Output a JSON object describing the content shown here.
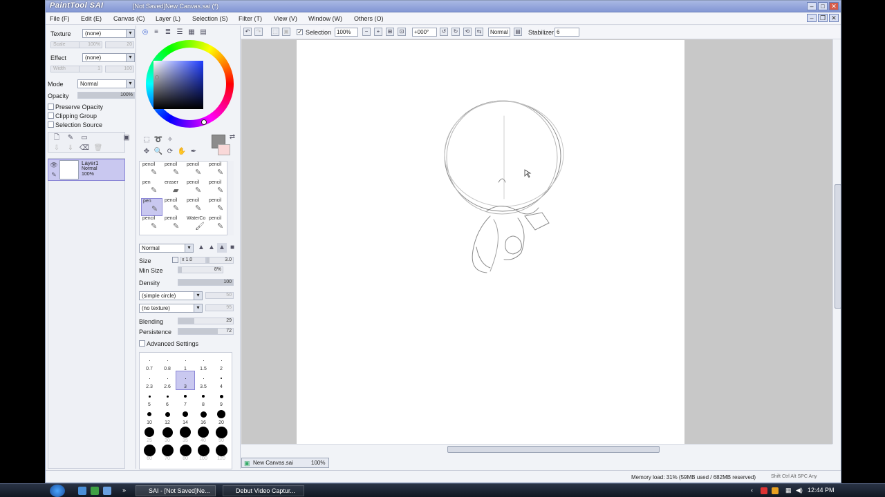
{
  "window": {
    "logo": "PaintTool SAI",
    "title": "[Not Saved]New Canvas.sai (*)"
  },
  "menu": [
    "File (F)",
    "Edit (E)",
    "Canvas (C)",
    "Layer (L)",
    "Selection (S)",
    "Filter (T)",
    "View (V)",
    "Window (W)",
    "Others (O)"
  ],
  "left": {
    "texture_label": "Texture",
    "texture_value": "(none)",
    "scale_label": "Scale",
    "scale_value": "100%",
    "scale_num": "20",
    "effect_label": "Effect",
    "effect_value": "(none)",
    "width_label": "Width",
    "width_value": "1",
    "width_num": "100",
    "mode_label": "Mode",
    "mode_value": "Normal",
    "opacity_label": "Opacity",
    "opacity_value": "100%",
    "preserve_opacity": "Preserve Opacity",
    "clipping_group": "Clipping Group",
    "selection_source": "Selection Source",
    "layer": {
      "name": "Layer1",
      "mode": "Normal",
      "opacity": "100%"
    }
  },
  "brushes": [
    {
      "name": "pencil",
      "icon": "pencil-icon"
    },
    {
      "name": "pencil",
      "icon": "pencil-icon"
    },
    {
      "name": "pencil",
      "icon": "pencil-icon"
    },
    {
      "name": "pencil",
      "icon": "pencil-icon"
    },
    {
      "name": "pen",
      "icon": "pen-icon"
    },
    {
      "name": "eraser",
      "icon": "eraser-icon"
    },
    {
      "name": "pencil",
      "icon": "pencil-icon"
    },
    {
      "name": "pencil",
      "icon": "pencil-icon"
    },
    {
      "name": "pen",
      "icon": "pen-icon",
      "selected": true
    },
    {
      "name": "pencil",
      "icon": "pencil-icon"
    },
    {
      "name": "pencil",
      "icon": "pencil-icon"
    },
    {
      "name": "pencil",
      "icon": "pencil-icon"
    },
    {
      "name": "pencil",
      "icon": "pencil-icon"
    },
    {
      "name": "pencil",
      "icon": "pencil-icon"
    },
    {
      "name": "WaterCo",
      "icon": "brush-icon"
    },
    {
      "name": "pencil",
      "icon": "pencil-icon"
    }
  ],
  "brush_settings": {
    "mode": "Normal",
    "size_label": "Size",
    "size_mult": "x 1.0",
    "size_value": "3.0",
    "minsize_label": "Min Size",
    "minsize_value": "8%",
    "minsize_fraction": 0.08,
    "density_label": "Density",
    "density_value": "100",
    "shape": "(simple circle)",
    "shape_num": "50",
    "texture": "(no texture)",
    "texture_num": "95",
    "blending_label": "Blending",
    "blending_value": "29",
    "blending_fraction": 0.29,
    "persistence_label": "Persistence",
    "persistence_value": "72",
    "persistence_fraction": 0.72,
    "advanced": "Advanced Settings"
  },
  "sizes": [
    {
      "v": "0.7",
      "d": 1
    },
    {
      "v": "0.8",
      "d": 1
    },
    {
      "v": "1",
      "d": 1
    },
    {
      "v": "1.5",
      "d": 1
    },
    {
      "v": "2",
      "d": 1
    },
    {
      "v": "2.3",
      "d": 1
    },
    {
      "v": "2.6",
      "d": 1
    },
    {
      "v": "3",
      "d": 1,
      "selected": true
    },
    {
      "v": "3.5",
      "d": 1
    },
    {
      "v": "4",
      "d": 2
    },
    {
      "v": "5",
      "d": 3
    },
    {
      "v": "6",
      "d": 3
    },
    {
      "v": "7",
      "d": 4
    },
    {
      "v": "8",
      "d": 4
    },
    {
      "v": "9",
      "d": 5
    },
    {
      "v": "10",
      "d": 6
    },
    {
      "v": "12",
      "d": 7
    },
    {
      "v": "14",
      "d": 8
    },
    {
      "v": "16",
      "d": 9
    },
    {
      "v": "20",
      "d": 12
    },
    {
      "v": "25",
      "d": 14
    },
    {
      "v": "30",
      "d": 15
    },
    {
      "v": "35",
      "d": 16
    },
    {
      "v": "40",
      "d": 16
    },
    {
      "v": "50",
      "d": 17
    },
    {
      "v": "60",
      "d": 17
    },
    {
      "v": "70",
      "d": 17
    },
    {
      "v": "80",
      "d": 17
    },
    {
      "v": "100",
      "d": 17
    },
    {
      "v": "120",
      "d": 17
    }
  ],
  "toolbar": {
    "selection_label": "Selection",
    "zoom": "100%",
    "rotate": "+000°",
    "blend": "Normal",
    "stabilizer_label": "Stabilizer",
    "stabilizer_value": "6"
  },
  "doc_tab": {
    "name": "New Canvas.sai",
    "zoom": "100%"
  },
  "status": {
    "memory": "Memory load: 31% (59MB used / 682MB reserved)",
    "keys": "Shift Ctrl Alt SPC Any"
  },
  "taskbar": {
    "tasks": [
      "SAI - [Not Saved]Ne...",
      "Debut Video Captur..."
    ],
    "clock": "12:44 PM"
  }
}
